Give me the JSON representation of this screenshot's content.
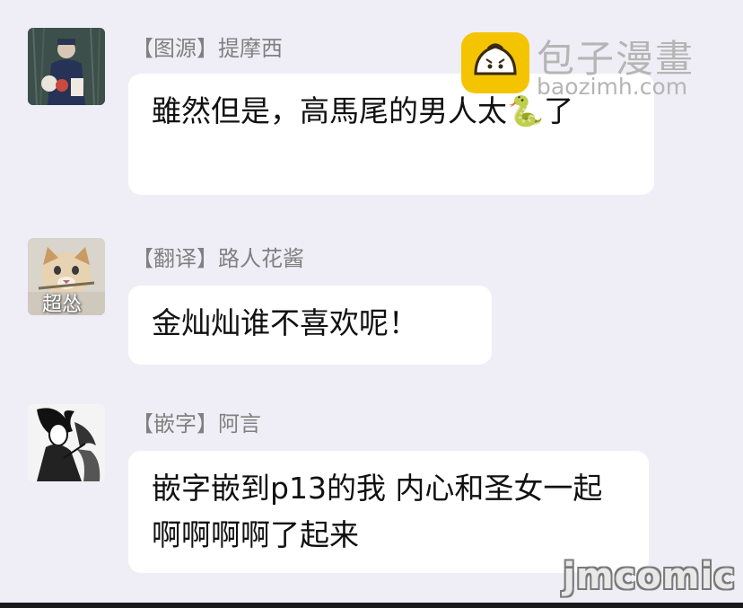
{
  "watermark": {
    "title": "包子漫畫",
    "domain": "baozimh.com",
    "bottom_text": "jmcomic"
  },
  "messages": [
    {
      "sender": "【图源】提摩西",
      "text": "雖然但是，高馬尾的男人太🐍了"
    },
    {
      "sender": "【翻译】路人花酱",
      "avatar_caption": "超怂",
      "text": "金灿灿谁不喜欢呢！"
    },
    {
      "sender": "【嵌字】阿言",
      "text": "嵌字嵌到p13的我 内心和圣女一起啊啊啊啊了起来"
    }
  ],
  "colors": {
    "background": "#efeef6",
    "bubble": "#ffffff",
    "sender_text": "#808080",
    "message_text": "#111111",
    "watermark_yellow": "#f5c400"
  }
}
